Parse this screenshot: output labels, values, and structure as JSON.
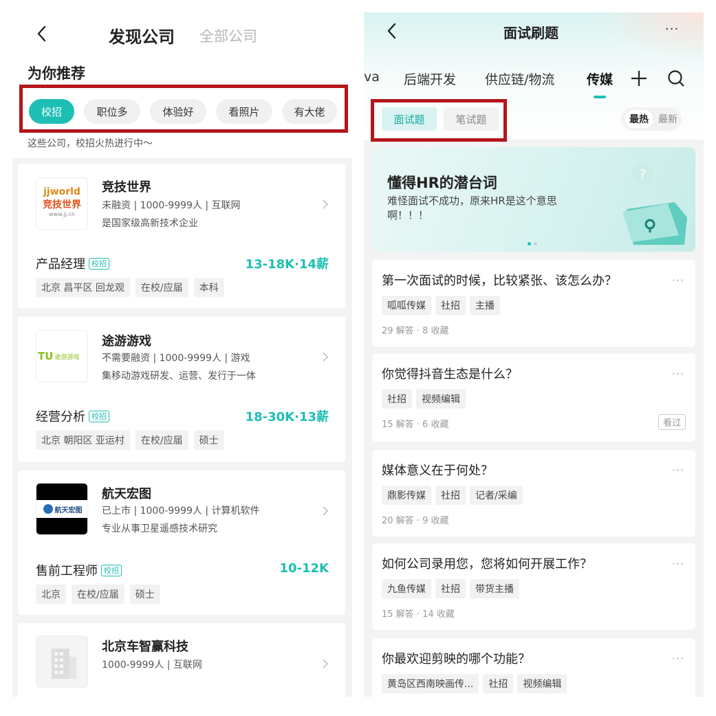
{
  "left": {
    "header": {
      "title": "发现公司",
      "alt_title": "全部公司"
    },
    "section_title": "为你推荐",
    "filters": [
      "校招",
      "职位多",
      "体验好",
      "看照片",
      "有大佬"
    ],
    "hint": "这些公司，校招火热进行中～",
    "companies": [
      {
        "name": "竞技世界",
        "info": "未融资 | 1000-9999人 | 互联网",
        "desc": "是国家级高新技术企业",
        "logo_text": [
          "jjworld",
          "竞技世界",
          "www.jj.cn"
        ],
        "job": "产品经理",
        "badge": "校招",
        "salary": "13-18K·14薪",
        "tags": [
          "北京 昌平区 回龙观",
          "在校/应届",
          "本科"
        ]
      },
      {
        "name": "途游游戏",
        "info": "不需要融资 | 1000-9999人 | 游戏",
        "desc": "集移动游戏研发、运营、发行于一体",
        "logo_text": [
          "TU",
          "途游游戏"
        ],
        "job": "经营分析",
        "badge": "校招",
        "salary": "18-30K·13薪",
        "tags": [
          "北京 朝阳区 亚运村",
          "在校/应届",
          "硕士"
        ]
      },
      {
        "name": "航天宏图",
        "info": "已上市 | 1000-9999人 | 计算机软件",
        "desc": "专业从事卫星遥感技术研究",
        "logo_text": [
          "航天宏图"
        ],
        "job": "售前工程师",
        "badge": "校招",
        "salary": "10-12K",
        "tags": [
          "北京",
          "在校/应届",
          "硕士"
        ]
      },
      {
        "name": "北京车智赢科技",
        "info": "1000-9999人 | 互联网"
      }
    ]
  },
  "right": {
    "header": {
      "title": "面试刷题",
      "more": "···"
    },
    "tabs": [
      "va",
      "后端开发",
      "供应链/物流",
      "传媒"
    ],
    "segments": [
      "面试题",
      "笔试题"
    ],
    "sort": [
      "最热",
      "最新"
    ],
    "banner": {
      "title": "懂得HR的潜台词",
      "subtitle": "难怪面试不成功，原来HR是这个意思啊！！！"
    },
    "questions": [
      {
        "title": "第一次面试的时候，比较紧张、该怎么办？",
        "tags": [
          "呱呱传媒",
          "社招",
          "主播"
        ],
        "meta": "29 解答 · 8 收藏"
      },
      {
        "title": "你觉得抖音生态是什么？",
        "tags": [
          "社招",
          "视频编辑"
        ],
        "meta": "15 解答 · 6 收藏",
        "seen": "看过"
      },
      {
        "title": "媒体意义在于何处？",
        "tags": [
          "鼎影传媒",
          "社招",
          "记者/采编"
        ],
        "meta": "20 解答 · 9 收藏"
      },
      {
        "title": "如何公司录用您，您将如何开展工作？",
        "tags": [
          "九鱼传媒",
          "社招",
          "带货主播"
        ],
        "meta": "15 解答 · 14 收藏"
      },
      {
        "title": "你最欢迎剪映的哪个功能？",
        "tags": [
          "黄岛区西南映画传...",
          "社招",
          "视频编辑"
        ]
      }
    ]
  },
  "colors": {
    "accent": "#1dbfb4",
    "highlight_box": "#b3161b"
  }
}
